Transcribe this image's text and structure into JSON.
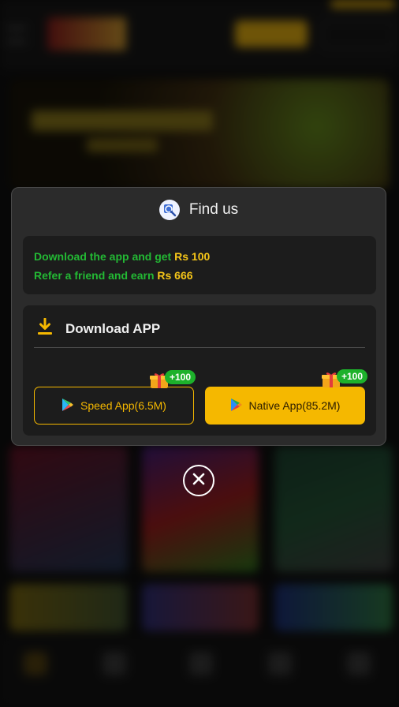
{
  "modal": {
    "title": "Find us",
    "promo": {
      "line1_text": "Download the app and get",
      "line1_value": "Rs 100",
      "line2_text": "Refer a friend and earn",
      "line2_value": "Rs 666"
    },
    "download": {
      "title": "Download APP",
      "speed_label": "Speed App(6.5M)",
      "speed_badge": "+100",
      "native_label": "Native App(85.2M)",
      "native_badge": "+100"
    }
  },
  "colors": {
    "accent": "#f5b800",
    "green": "#23b934",
    "panel": "#1c1c1c",
    "modal": "#2b2b2b"
  },
  "icons": [
    "magnifier-icon",
    "download-icon",
    "play-store-icon",
    "gift-icon",
    "close-icon"
  ]
}
